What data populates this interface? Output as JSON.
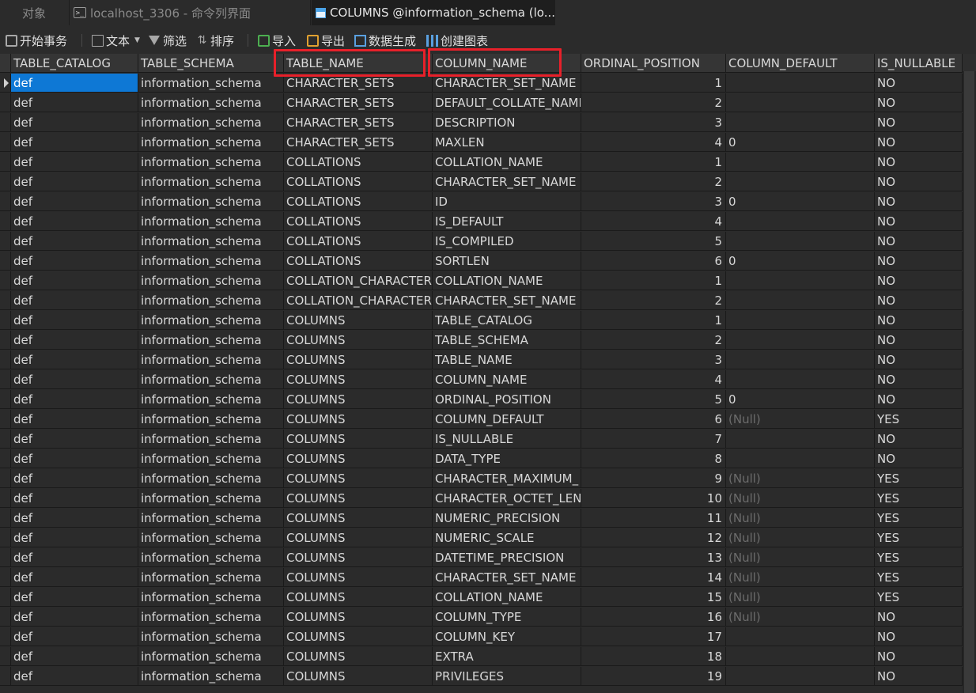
{
  "tabs": [
    {
      "label": "对象"
    },
    {
      "label": "localhost_3306 - 命令列界面"
    },
    {
      "label": "COLUMNS @information_schema (lo..."
    }
  ],
  "toolbar": {
    "begin_transaction": "开始事务",
    "text": "文本",
    "filter": "筛选",
    "sort": "排序",
    "import": "导入",
    "export": "导出",
    "data_generation": "数据生成",
    "create_chart": "创建图表"
  },
  "grid": {
    "columns": [
      "TABLE_CATALOG",
      "TABLE_SCHEMA",
      "TABLE_NAME",
      "COLUMN_NAME",
      "ORDINAL_POSITION",
      "COLUMN_DEFAULT",
      "IS_NULLABLE"
    ],
    "highlighted_columns": [
      "TABLE_NAME",
      "COLUMN_NAME"
    ],
    "selected_cell": "def",
    "rows": [
      [
        "def",
        "information_schema",
        "CHARACTER_SETS",
        "CHARACTER_SET_NAME",
        "1",
        "",
        "NO"
      ],
      [
        "def",
        "information_schema",
        "CHARACTER_SETS",
        "DEFAULT_COLLATE_NAME",
        "2",
        "",
        "NO"
      ],
      [
        "def",
        "information_schema",
        "CHARACTER_SETS",
        "DESCRIPTION",
        "3",
        "",
        "NO"
      ],
      [
        "def",
        "information_schema",
        "CHARACTER_SETS",
        "MAXLEN",
        "4",
        "0",
        "NO"
      ],
      [
        "def",
        "information_schema",
        "COLLATIONS",
        "COLLATION_NAME",
        "1",
        "",
        "NO"
      ],
      [
        "def",
        "information_schema",
        "COLLATIONS",
        "CHARACTER_SET_NAME",
        "2",
        "",
        "NO"
      ],
      [
        "def",
        "information_schema",
        "COLLATIONS",
        "ID",
        "3",
        "0",
        "NO"
      ],
      [
        "def",
        "information_schema",
        "COLLATIONS",
        "IS_DEFAULT",
        "4",
        "",
        "NO"
      ],
      [
        "def",
        "information_schema",
        "COLLATIONS",
        "IS_COMPILED",
        "5",
        "",
        "NO"
      ],
      [
        "def",
        "information_schema",
        "COLLATIONS",
        "SORTLEN",
        "6",
        "0",
        "NO"
      ],
      [
        "def",
        "information_schema",
        "COLLATION_CHARACTER",
        "COLLATION_NAME",
        "1",
        "",
        "NO"
      ],
      [
        "def",
        "information_schema",
        "COLLATION_CHARACTER",
        "CHARACTER_SET_NAME",
        "2",
        "",
        "NO"
      ],
      [
        "def",
        "information_schema",
        "COLUMNS",
        "TABLE_CATALOG",
        "1",
        "",
        "NO"
      ],
      [
        "def",
        "information_schema",
        "COLUMNS",
        "TABLE_SCHEMA",
        "2",
        "",
        "NO"
      ],
      [
        "def",
        "information_schema",
        "COLUMNS",
        "TABLE_NAME",
        "3",
        "",
        "NO"
      ],
      [
        "def",
        "information_schema",
        "COLUMNS",
        "COLUMN_NAME",
        "4",
        "",
        "NO"
      ],
      [
        "def",
        "information_schema",
        "COLUMNS",
        "ORDINAL_POSITION",
        "5",
        "0",
        "NO"
      ],
      [
        "def",
        "information_schema",
        "COLUMNS",
        "COLUMN_DEFAULT",
        "6",
        "(Null)",
        "YES"
      ],
      [
        "def",
        "information_schema",
        "COLUMNS",
        "IS_NULLABLE",
        "7",
        "",
        "NO"
      ],
      [
        "def",
        "information_schema",
        "COLUMNS",
        "DATA_TYPE",
        "8",
        "",
        "NO"
      ],
      [
        "def",
        "information_schema",
        "COLUMNS",
        "CHARACTER_MAXIMUM_",
        "9",
        "(Null)",
        "YES"
      ],
      [
        "def",
        "information_schema",
        "COLUMNS",
        "CHARACTER_OCTET_LENG",
        "10",
        "(Null)",
        "YES"
      ],
      [
        "def",
        "information_schema",
        "COLUMNS",
        "NUMERIC_PRECISION",
        "11",
        "(Null)",
        "YES"
      ],
      [
        "def",
        "information_schema",
        "COLUMNS",
        "NUMERIC_SCALE",
        "12",
        "(Null)",
        "YES"
      ],
      [
        "def",
        "information_schema",
        "COLUMNS",
        "DATETIME_PRECISION",
        "13",
        "(Null)",
        "YES"
      ],
      [
        "def",
        "information_schema",
        "COLUMNS",
        "CHARACTER_SET_NAME",
        "14",
        "(Null)",
        "YES"
      ],
      [
        "def",
        "information_schema",
        "COLUMNS",
        "COLLATION_NAME",
        "15",
        "(Null)",
        "YES"
      ],
      [
        "def",
        "information_schema",
        "COLUMNS",
        "COLUMN_TYPE",
        "16",
        "(Null)",
        "NO"
      ],
      [
        "def",
        "information_schema",
        "COLUMNS",
        "COLUMN_KEY",
        "17",
        "",
        "NO"
      ],
      [
        "def",
        "information_schema",
        "COLUMNS",
        "EXTRA",
        "18",
        "",
        "NO"
      ],
      [
        "def",
        "information_schema",
        "COLUMNS",
        "PRIVILEGES",
        "19",
        "",
        "NO"
      ]
    ]
  },
  "colors": {
    "background": "#2b2b2b",
    "header_background": "#353535",
    "selection": "#0e78d5",
    "highlight_box": "#e8202a",
    "null_text": "#6c6c6c"
  }
}
